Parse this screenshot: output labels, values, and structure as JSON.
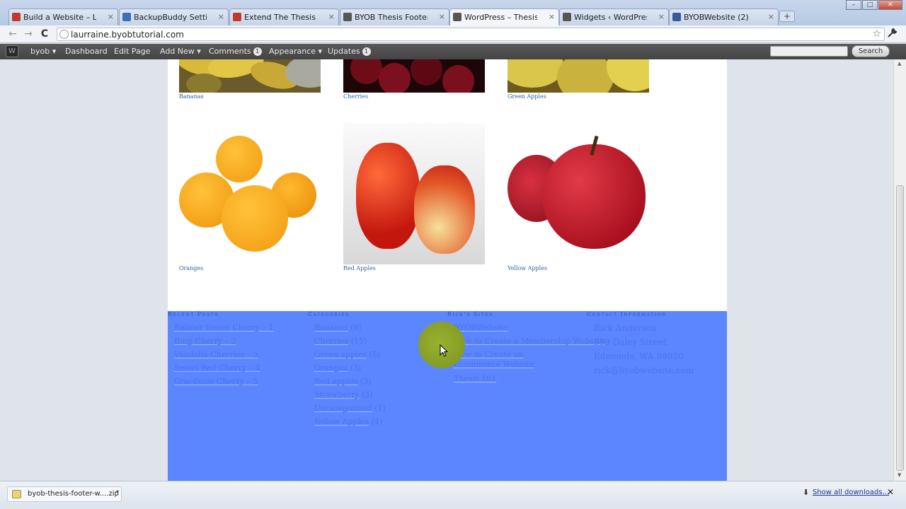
{
  "browser": {
    "tabs": [
      {
        "title": "Build a Website – Live Call |",
        "favicon_color": "#c0392b",
        "active": false
      },
      {
        "title": "BackupBuddy Settings ‹ Bui",
        "favicon_color": "#3b6fb6",
        "active": false
      },
      {
        "title": "Extend The Thesis Theme w",
        "favicon_color": "#c0392b",
        "active": false
      },
      {
        "title": "BYOB Thesis Footer Widget",
        "favicon_color": "#555555",
        "active": false
      },
      {
        "title": "WordPress – Thesis – jQuery",
        "favicon_color": "#555555",
        "active": true
      },
      {
        "title": "Widgets ‹ WordPress – Thes",
        "favicon_color": "#555555",
        "active": false
      },
      {
        "title": "BYOBWebsite (2)",
        "favicon_color": "#3b5998",
        "active": false
      }
    ],
    "new_tab_symbol": "+",
    "tab_close_symbol": "×",
    "window_controls": [
      "–",
      "□",
      "✕"
    ],
    "url": "laurraine.byobtutorial.com",
    "back_symbol": "←",
    "forward_symbol": "→",
    "reload_symbol": "C",
    "star_symbol": "☆",
    "wrench_symbol": "🔧"
  },
  "admin_bar": {
    "site": "byob ▾",
    "dashboard": "Dashboard",
    "edit_page": "Edit Page",
    "add_new": "Add New ▾",
    "comments": "Comments",
    "comments_count": "1",
    "appearance": "Appearance ▾",
    "updates": "Updates",
    "updates_count": "1",
    "search_button": "Search",
    "search_value": ""
  },
  "gallery": {
    "row1": [
      {
        "caption": "Bananas"
      },
      {
        "caption": "Cherries"
      },
      {
        "caption": "Green Apples"
      }
    ],
    "row2": [
      {
        "caption": "Oranges"
      },
      {
        "caption": "Red Apples"
      },
      {
        "caption": "Yellow Apples"
      }
    ]
  },
  "footer": {
    "recent_posts": {
      "heading": "Recent Posts",
      "items": [
        "Rainier Sweet Cherry – 1",
        "Bing Cherry – 2",
        "Vandalia Cherries – 3",
        "Sweet Red Cherry – 4",
        "Gracilusie Cherry – 5"
      ]
    },
    "categories": {
      "heading": "Categories",
      "items": [
        {
          "name": "Bananas",
          "count": "(8)"
        },
        {
          "name": "Cherries",
          "count": "(15)"
        },
        {
          "name": "Green apples",
          "count": "(5)"
        },
        {
          "name": "Oranges",
          "count": "(3)"
        },
        {
          "name": "Red apples",
          "count": "(3)"
        },
        {
          "name": "Strawberry",
          "count": "(3)"
        },
        {
          "name": "Uncategorized",
          "count": "(1)"
        },
        {
          "name": "Yellow Apples",
          "count": "(4)"
        }
      ]
    },
    "ricks_sites": {
      "heading": "Rick's Sites",
      "items": [
        "BYOBWebsite",
        "How to Create a Membership Website",
        "How to Create an Ecommerce Website",
        "Thesis 101"
      ]
    },
    "contact": {
      "heading": "Contact Information",
      "lines": [
        "Rick Anderson",
        "999 Daley Street",
        "Edmonds, WA 98020",
        "rick@byobwebsite.com"
      ]
    }
  },
  "downloads": {
    "file": "byob-thesis-footer-w....zip",
    "show_all": "Show all downloads...",
    "close_symbol": "✕"
  },
  "colors": {
    "footer_bg": "#5b86ff",
    "admin_bar": "#464646",
    "caption_link": "#2e6496"
  }
}
